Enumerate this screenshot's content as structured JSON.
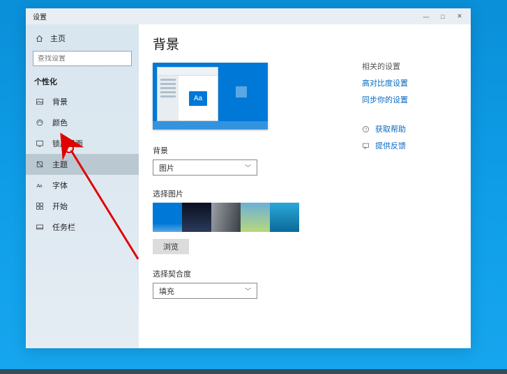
{
  "window": {
    "title": "设置",
    "controls": {
      "min": "—",
      "max": "□",
      "close": "✕"
    }
  },
  "sidebar": {
    "home": "主页",
    "search_placeholder": "查找设置",
    "section": "个性化",
    "items": [
      {
        "label": "背景"
      },
      {
        "label": "颜色"
      },
      {
        "label": "锁屏界面"
      },
      {
        "label": "主题"
      },
      {
        "label": "字体"
      },
      {
        "label": "开始"
      },
      {
        "label": "任务栏"
      }
    ]
  },
  "main": {
    "title": "背景",
    "preview_sample": "Aa",
    "bg_label": "背景",
    "bg_value": "图片",
    "choose_label": "选择图片",
    "browse": "浏览",
    "fit_label": "选择契合度",
    "fit_value": "填充"
  },
  "related": {
    "heading": "相关的设置",
    "contrast": "高对比度设置",
    "sync": "同步你的设置",
    "help": "获取帮助",
    "feedback": "提供反馈"
  }
}
